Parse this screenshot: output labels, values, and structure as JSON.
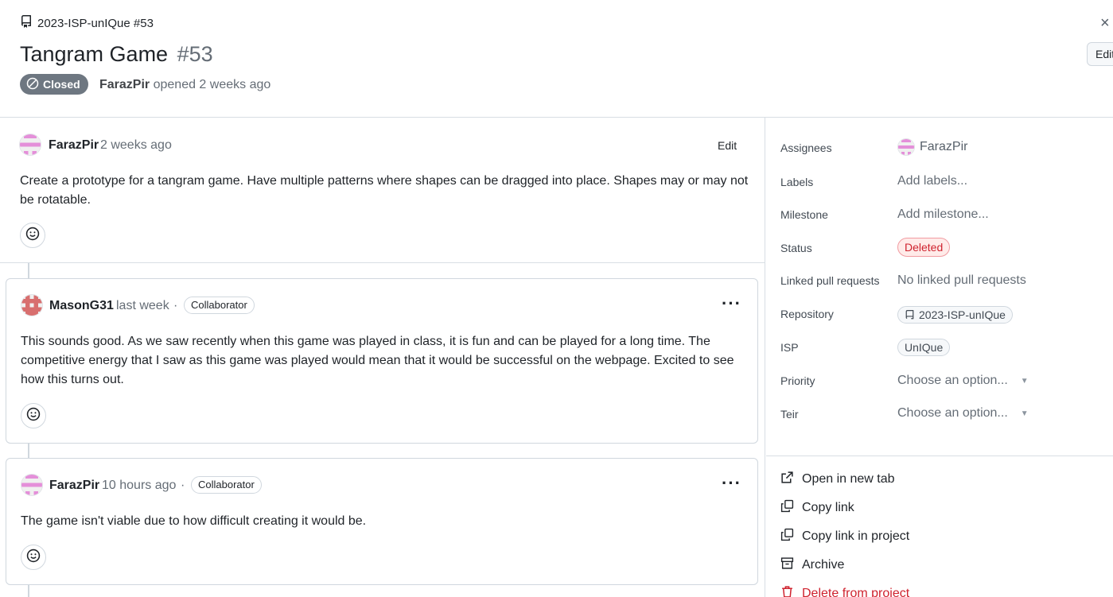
{
  "header": {
    "repo": "2023-ISP-unIQue #53",
    "title": "Tangram Game",
    "number": "#53",
    "status": "Closed",
    "opened_by": "FarazPir",
    "opened_text": "opened 2 weeks ago",
    "close_icon": "×",
    "edit_label": "Edit"
  },
  "issue": {
    "author": "FarazPir",
    "time": "2 weeks ago",
    "edit_label": "Edit",
    "body": "Create a prototype for a tangram game. Have multiple patterns where shapes can be dragged into place. Shapes may or may not be rotatable."
  },
  "comments": [
    {
      "author": "MasonG31",
      "time": "last week",
      "role": "Collaborator",
      "body": "This sounds good. As we saw recently when this game was played in class, it is fun and can be played for a long time. The competitive energy that I saw as this game was played would mean that it would be successful on the webpage. Excited to see how this turns out."
    },
    {
      "author": "FarazPir",
      "time": "10 hours ago",
      "role": "Collaborator",
      "body": "The game isn't viable due to how difficult creating it would be."
    }
  ],
  "sidebar": {
    "assignees": {
      "label": "Assignees",
      "value": "FarazPir"
    },
    "labels": {
      "label": "Labels",
      "value": "Add labels..."
    },
    "milestone": {
      "label": "Milestone",
      "value": "Add milestone..."
    },
    "status": {
      "label": "Status",
      "value": "Deleted",
      "color": "#cf222e"
    },
    "linked_prs": {
      "label": "Linked pull requests",
      "value": "No linked pull requests"
    },
    "repository": {
      "label": "Repository",
      "value": "2023-ISP-unIQue"
    },
    "isp": {
      "label": "ISP",
      "value": "UnIQue"
    },
    "priority": {
      "label": "Priority",
      "value": "Choose an option..."
    },
    "teir": {
      "label": "Teir",
      "value": "Choose an option..."
    },
    "actions": {
      "open_new_tab": "Open in new tab",
      "copy_link": "Copy link",
      "copy_link_project": "Copy link in project",
      "archive": "Archive",
      "delete": "Delete from project"
    }
  },
  "colors": {
    "closed_badge": "#6e7781",
    "danger": "#cf222e",
    "border": "#d0d7de"
  }
}
